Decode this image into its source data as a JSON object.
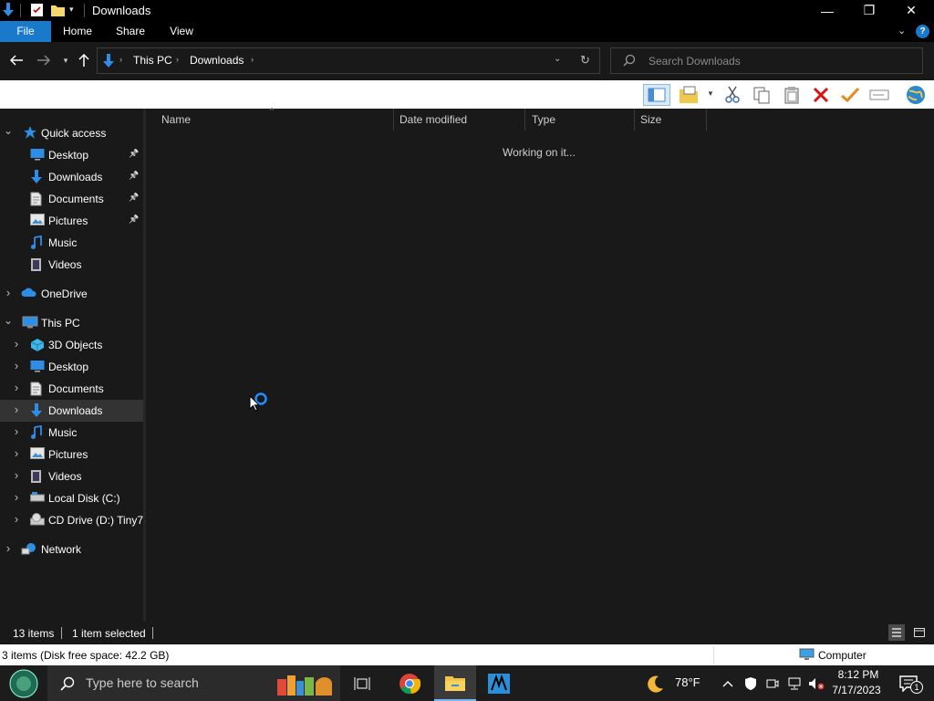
{
  "window": {
    "title": "Downloads",
    "minimize_glyph": "—",
    "restore_glyph": "❐",
    "close_glyph": "✕"
  },
  "ribbon": {
    "tabs": [
      "File",
      "Home",
      "Share",
      "View"
    ],
    "help_glyph": "?"
  },
  "address": {
    "crumbs": [
      "This PC",
      "Downloads"
    ],
    "search_placeholder": "Search Downloads"
  },
  "columns": [
    "Name",
    "Date modified",
    "Type",
    "Size"
  ],
  "content": {
    "message": "Working on it..."
  },
  "nav": {
    "quick_access": {
      "label": "Quick access",
      "items": [
        {
          "label": "Desktop",
          "icon": "desktop-icon",
          "pinned": true
        },
        {
          "label": "Downloads",
          "icon": "downloads-icon",
          "pinned": true
        },
        {
          "label": "Documents",
          "icon": "documents-icon",
          "pinned": true
        },
        {
          "label": "Pictures",
          "icon": "pictures-icon",
          "pinned": true
        },
        {
          "label": "Music",
          "icon": "music-icon",
          "pinned": false
        },
        {
          "label": "Videos",
          "icon": "videos-icon",
          "pinned": false
        }
      ]
    },
    "onedrive": "OneDrive",
    "this_pc": {
      "label": "This PC",
      "items": [
        {
          "label": "3D Objects",
          "icon": "3d-objects-icon"
        },
        {
          "label": "Desktop",
          "icon": "desktop-icon"
        },
        {
          "label": "Documents",
          "icon": "documents-icon"
        },
        {
          "label": "Downloads",
          "icon": "downloads-icon",
          "selected": true
        },
        {
          "label": "Music",
          "icon": "music-icon"
        },
        {
          "label": "Pictures",
          "icon": "pictures-icon"
        },
        {
          "label": "Videos",
          "icon": "videos-icon"
        },
        {
          "label": "Local Disk (C:)",
          "icon": "local-disk-icon"
        },
        {
          "label": "CD Drive (D:) Tiny7",
          "icon": "cd-drive-icon"
        }
      ]
    },
    "network": "Network"
  },
  "status": {
    "items_count": "13 items",
    "selected": "1 item selected"
  },
  "info": {
    "left": "3 items (Disk free space: 42.2 GB)",
    "right": "Computer"
  },
  "taskbar": {
    "search_placeholder": "Type here to search",
    "weather": "78°F",
    "time": "8:12 PM",
    "date": "7/17/2023",
    "notification_count": "1"
  },
  "colors": {
    "accent": "#1979ca",
    "selection": "#333333",
    "folder_blue": "#2e8ee6"
  }
}
